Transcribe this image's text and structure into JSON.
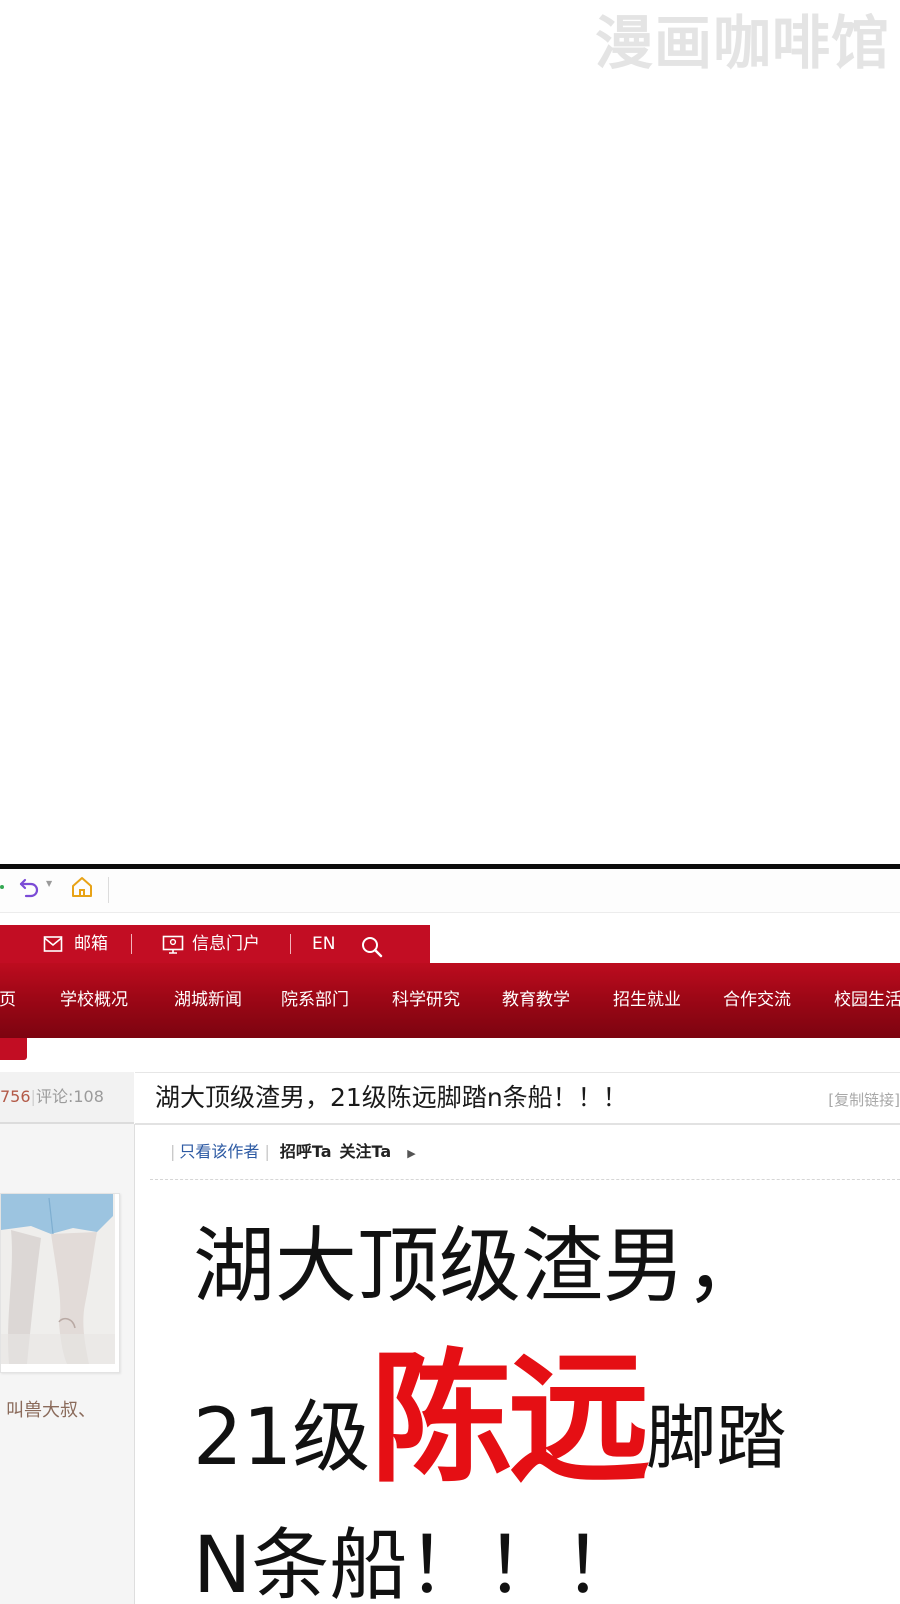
{
  "watermark": "漫画咖啡馆",
  "toolbar": {
    "icons": [
      "undo-icon",
      "dropdown-caret-icon",
      "home-icon"
    ]
  },
  "topbar": {
    "mail_label": "邮箱",
    "portal_label": "信息门户",
    "lang_label": "EN",
    "icons": [
      "mail-icon",
      "portal-icon",
      "search-icon"
    ]
  },
  "nav": {
    "items": [
      "首页",
      "学校概况",
      "湖城新闻",
      "院系部门",
      "科学研究",
      "教育教学",
      "招生就业",
      "合作交流",
      "校园生活"
    ]
  },
  "post": {
    "views": "756",
    "comments_label": "评论:",
    "comments": "108",
    "title": "湖大顶级渣男，21级陈远脚踏n条船！！！",
    "copy_link": "[复制链接]",
    "only_author": "只看该作者",
    "greet": "招呼Ta",
    "follow": "关注Ta",
    "username": "叫兽大叔、"
  },
  "content": {
    "line1": "湖大顶级渣男，",
    "line2_prefix": "21级",
    "line2_name": "陈远",
    "line2_suffix": "脚踏",
    "line3": "N条船！！！"
  },
  "colors": {
    "brand_red": "#c20d23",
    "nav_dark_red": "#7c0410",
    "highlight_red": "#e50f14",
    "link_blue": "#2d5aa3"
  }
}
